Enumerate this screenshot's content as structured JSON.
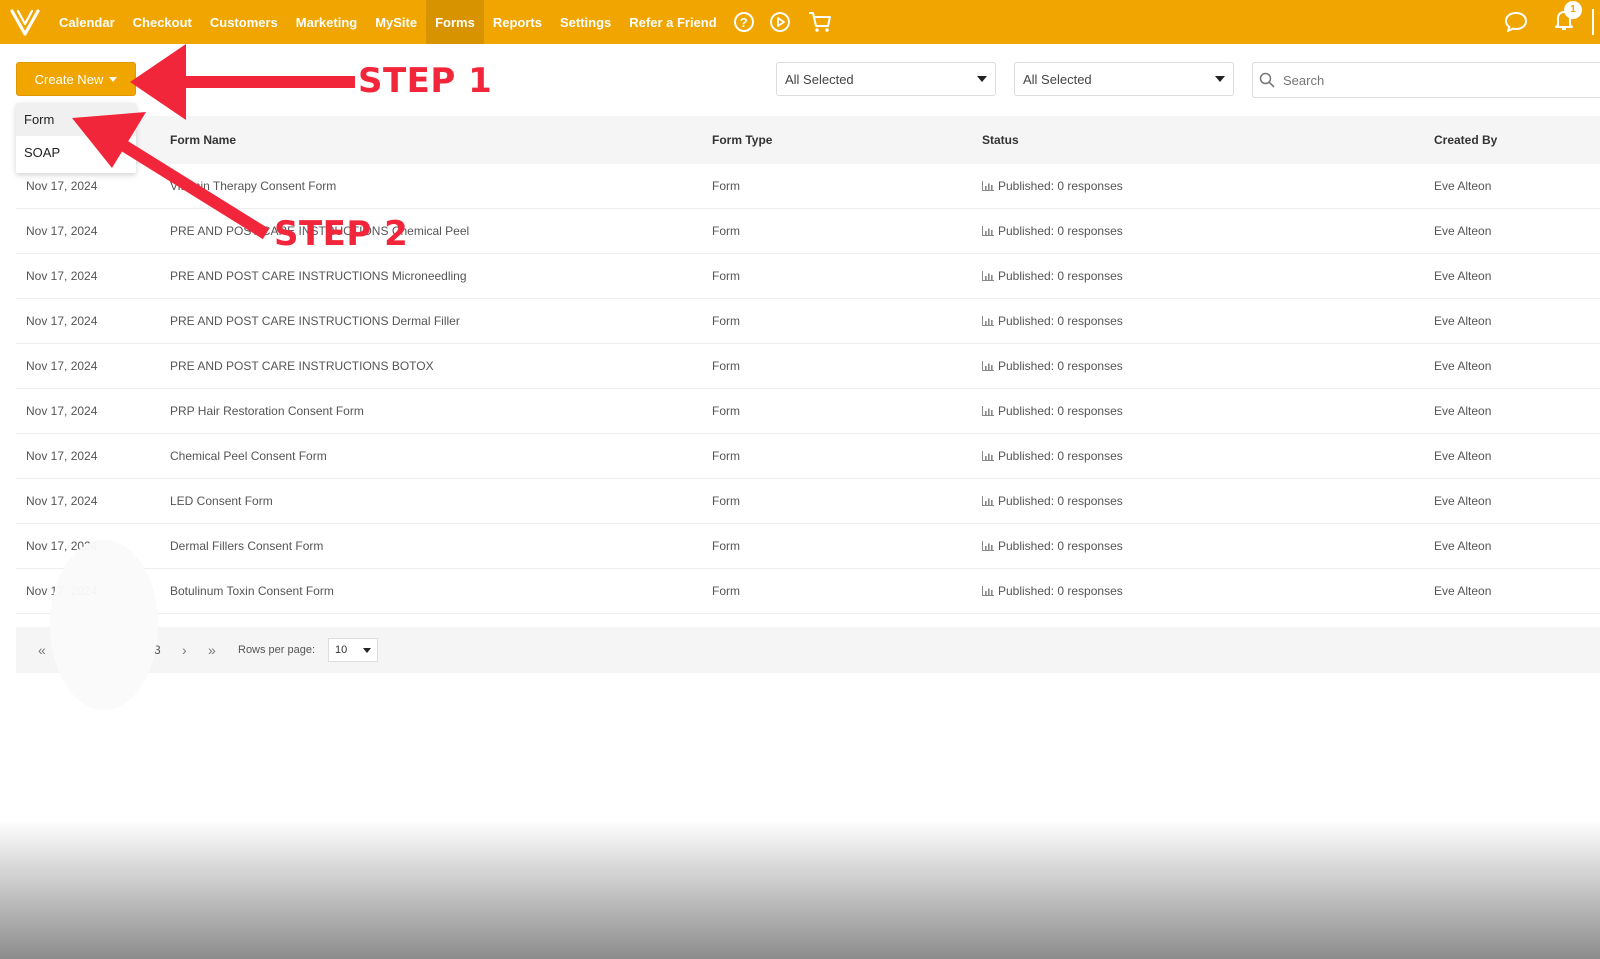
{
  "nav": {
    "items": [
      "Calendar",
      "Checkout",
      "Customers",
      "Marketing",
      "MySite",
      "Forms",
      "Reports",
      "Settings",
      "Refer a Friend"
    ],
    "active": "Forms",
    "help_icon": "?",
    "notification_count": "1"
  },
  "toolbar": {
    "create_new_label": "Create New",
    "filter1_value": "All Selected",
    "filter2_value": "All Selected",
    "search_placeholder": "Search"
  },
  "dropdown": {
    "items": [
      "Form",
      "SOAP"
    ]
  },
  "table": {
    "headers": [
      "Form Name",
      "Form Type",
      "Status",
      "Created By"
    ],
    "rows": [
      {
        "date": "Nov 17, 2024",
        "name": "Vitamin Therapy Consent Form",
        "type": "Form",
        "status": "Published: 0 responses",
        "created_by": "Eve Alteon"
      },
      {
        "date": "Nov 17, 2024",
        "name": "PRE AND POST CARE INSTRUCTIONS Chemical Peel",
        "type": "Form",
        "status": "Published: 0 responses",
        "created_by": "Eve Alteon"
      },
      {
        "date": "Nov 17, 2024",
        "name": "PRE AND POST CARE INSTRUCTIONS Microneedling",
        "type": "Form",
        "status": "Published: 0 responses",
        "created_by": "Eve Alteon"
      },
      {
        "date": "Nov 17, 2024",
        "name": "PRE AND POST CARE INSTRUCTIONS Dermal Filler",
        "type": "Form",
        "status": "Published: 0 responses",
        "created_by": "Eve Alteon"
      },
      {
        "date": "Nov 17, 2024",
        "name": "PRE AND POST CARE INSTRUCTIONS BOTOX",
        "type": "Form",
        "status": "Published: 0 responses",
        "created_by": "Eve Alteon"
      },
      {
        "date": "Nov 17, 2024",
        "name": "PRP Hair Restoration Consent Form",
        "type": "Form",
        "status": "Published: 0 responses",
        "created_by": "Eve Alteon"
      },
      {
        "date": "Nov 17, 2024",
        "name": "Chemical Peel Consent Form",
        "type": "Form",
        "status": "Published: 0 responses",
        "created_by": "Eve Alteon"
      },
      {
        "date": "Nov 17, 2024",
        "name": "LED Consent Form",
        "type": "Form",
        "status": "Published: 0 responses",
        "created_by": "Eve Alteon"
      },
      {
        "date": "Nov 17, 2024",
        "name": "Dermal Fillers Consent Form",
        "type": "Form",
        "status": "Published: 0 responses",
        "created_by": "Eve Alteon"
      },
      {
        "date": "Nov 17, 2024",
        "name": "Botulinum Toxin Consent Form",
        "type": "Form",
        "status": "Published: 0 responses",
        "created_by": "Eve Alteon"
      }
    ]
  },
  "pagination": {
    "first": "«",
    "page_visible": "3",
    "next": "›",
    "last": "»",
    "rows_per_page_label": "Rows per page:",
    "rows_per_page_value": "10"
  },
  "annotations": {
    "step1": "STEP 1",
    "step2": "STEP 2"
  },
  "colors": {
    "brand": "#f0a500",
    "annotation": "#f2263a"
  }
}
